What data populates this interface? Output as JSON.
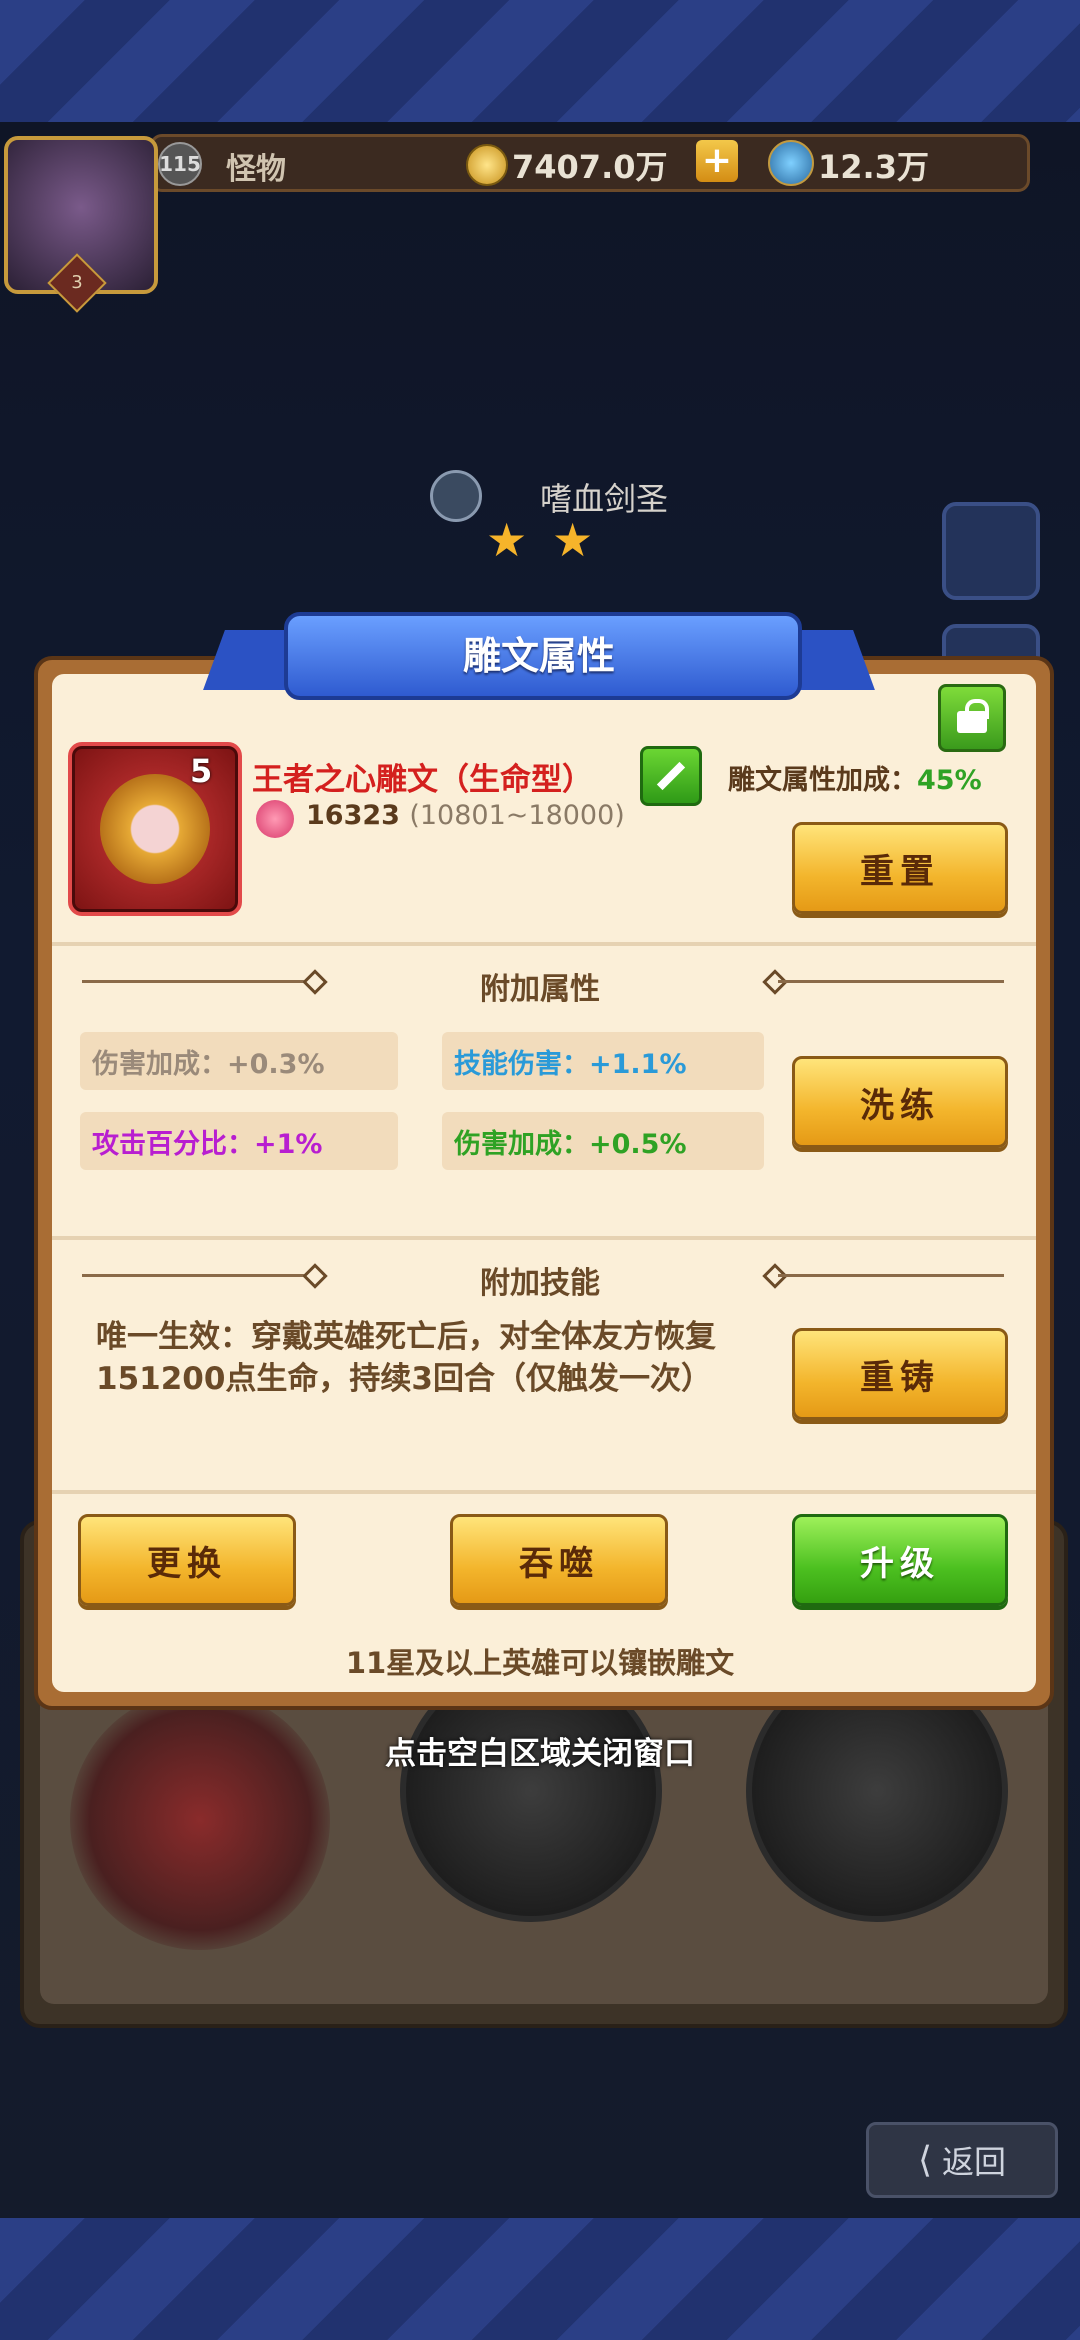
{
  "top_bar": {
    "avatar_level": "3",
    "player_level": "115",
    "player_name": "怪物",
    "gold": "7407.0万",
    "plus_label": "+",
    "gems": "12.3万"
  },
  "hero": {
    "name": "嗜血剑圣",
    "stars": [
      "★",
      "★"
    ]
  },
  "dialog": {
    "title": "雕文属性",
    "rune": {
      "level": "5",
      "name": "王者之心雕文（生命型）",
      "hp_value": "16323",
      "hp_range": "(10801~18000)",
      "bonus_label": "雕文属性加成：",
      "bonus_value": "45%"
    },
    "reset_button": "重置",
    "extra_attr_title": "附加属性",
    "attributes": [
      {
        "label": "伤害加成：+0.3%",
        "color": "#9a8a7a"
      },
      {
        "label": "技能伤害：+1.1%",
        "color": "#2a9ad8"
      },
      {
        "label": "攻击百分比：+1%",
        "color": "#b81ed0"
      },
      {
        "label": "伤害加成：+0.5%",
        "color": "#2fa224"
      }
    ],
    "refine_button": "洗练",
    "extra_skill_title": "附加技能",
    "skill_text": "唯一生效：穿戴英雄死亡后，对全体友方恢复151200点生命，持续3回合（仅触发一次）",
    "recast_button": "重铸",
    "replace_button": "更换",
    "devour_button": "吞噬",
    "upgrade_button": "升级",
    "footer_note": "11星及以上英雄可以镶嵌雕文"
  },
  "close_hint": "点击空白区域关闭窗口",
  "back_button": "返回",
  "colors": {
    "dialog_bg": "#fbefd8",
    "ribbon_blue": "#3f6fe0",
    "button_yellow": "#f3b52c",
    "button_green": "#4cc020",
    "rune_name_red": "#d4201e",
    "bonus_green": "#2fa224"
  },
  "icons": [
    "coin-icon",
    "gem-icon",
    "heart-icon",
    "lock-icon",
    "edit-icon",
    "back-arrow-icon"
  ]
}
